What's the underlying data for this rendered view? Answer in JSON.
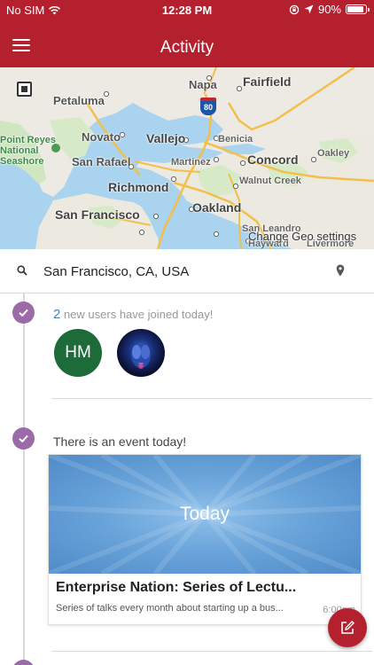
{
  "status_bar": {
    "carrier": "No SIM",
    "time": "12:28 PM",
    "battery_text": "90%",
    "battery_level": 0.9
  },
  "navbar": {
    "title": "Activity"
  },
  "map": {
    "places": {
      "petaluma": "Petaluma",
      "napa": "Napa",
      "fairfield": "Fairfield",
      "novato": "Novato",
      "vallejo": "Vallejo",
      "benicia": "Benicia",
      "point_reyes": "Point Reyes\nNational\nSeashore",
      "san_rafael": "San Rafael",
      "martinez": "Martinez",
      "concord": "Concord",
      "oakley": "Oakley",
      "richmond": "Richmond",
      "walnut_creek": "Walnut Creek",
      "san_francisco": "San Francisco",
      "oakland": "Oakland",
      "san_leandro": "San Leandro",
      "hayward": "Hayward",
      "livermore": "Livermore"
    },
    "highway_shield": "80",
    "geo_settings_link": "Change Geo settings"
  },
  "search": {
    "value": "San Francisco, CA, USA"
  },
  "feed": {
    "new_users": {
      "count": "2",
      "text": " new users have joined today!",
      "avatars": [
        {
          "initials": "HM",
          "color": "#1e6b3a"
        },
        {
          "initials": ""
        }
      ]
    },
    "event": {
      "heading": "There is an event today!",
      "banner_label": "Today",
      "title": "Enterprise Nation: Series of Lectu...",
      "description": "Series of talks every month about starting up a bus...",
      "time": "6:00pm"
    }
  },
  "colors": {
    "brand": "#b5202e",
    "timeline_check": "#9b6aa8",
    "accent_count": "#3d86c6"
  },
  "icons": {
    "menu": "hamburger-menu-icon",
    "search": "search-icon",
    "location": "location-pin-icon",
    "check": "check-icon",
    "compose": "compose-icon"
  }
}
